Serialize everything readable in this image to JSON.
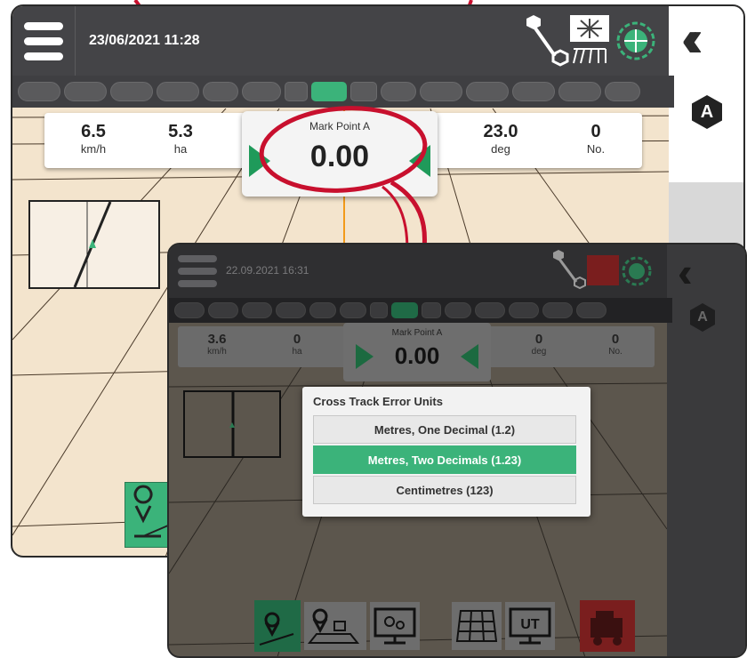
{
  "back_screen": {
    "datetime": "23/06/2021 11:28",
    "stats": [
      {
        "value": "6.5",
        "unit": "km/h"
      },
      {
        "value": "5.3",
        "unit": "ha"
      },
      {
        "value": "23.0",
        "unit": "deg"
      },
      {
        "value": "0",
        "unit": "No."
      }
    ],
    "cross_track": {
      "label": "Mark Point A",
      "value": "0.00"
    },
    "side_badge": "A"
  },
  "front_screen": {
    "datetime": "22.09.2021 16:31",
    "stats": [
      {
        "value": "3.6",
        "unit": "km/h"
      },
      {
        "value": "0",
        "unit": "ha"
      },
      {
        "value": "0",
        "unit": "deg"
      },
      {
        "value": "0",
        "unit": "No."
      }
    ],
    "cross_track": {
      "label": "Mark Point A",
      "value": "0.00"
    },
    "side_badge": "A",
    "popup": {
      "title": "Cross Track Error Units",
      "options": [
        {
          "label": "Metres, One Decimal  (1.2)",
          "selected": false
        },
        {
          "label": "Metres, Two Decimals  (1.23)",
          "selected": true
        },
        {
          "label": "Centimetres  (123)",
          "selected": false
        }
      ]
    }
  },
  "colors": {
    "accent_green": "#3bb37a",
    "arrow_green": "#1f9a5a",
    "callout_red": "#c8102e",
    "bar_dark": "#444447",
    "field_tan": "#f3e4cd"
  }
}
